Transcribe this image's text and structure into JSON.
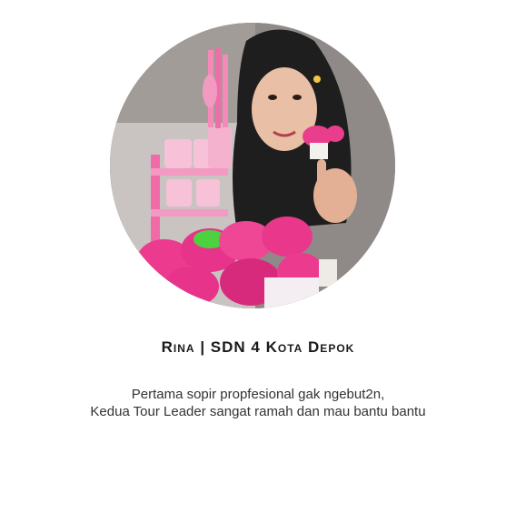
{
  "testimonial": {
    "avatar_icon": "avatar-photo",
    "name": "Rina | SDN 4 Kota Depok",
    "quote_lines": [
      "Pertama sopir propfesional gak ngebut2n,",
      "Kedua Tour Leader sangat ramah dan mau bantu bantu"
    ]
  }
}
